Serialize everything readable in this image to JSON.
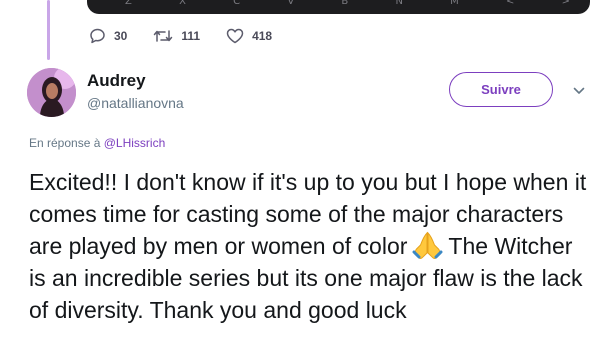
{
  "media": {
    "keys": [
      "Z",
      "X",
      "C",
      "V",
      "B",
      "N",
      "M",
      "<",
      ">"
    ]
  },
  "actions": {
    "replies": "30",
    "retweets": "111",
    "likes": "418"
  },
  "tweet": {
    "author_name": "Audrey",
    "author_handle": "@natallianovna",
    "follow_label": "Suivre",
    "reply_prefix": "En réponse à",
    "reply_to": "@LHissrich",
    "text_before_emoji": "Excited!! I don't know if it's up to you but I hope when it comes time for casting some of the major characters are played by men or women of color",
    "emoji": "folded-hands",
    "text_after_emoji": "The Witcher is an incredible series but its one major flaw is the lack of diversity. Thank you and good luck"
  },
  "colors": {
    "accent": "#7c3fbf",
    "thread_line": "#c9a6e8",
    "secondary_text": "#657786",
    "media_bg": "#1d1d1f"
  }
}
